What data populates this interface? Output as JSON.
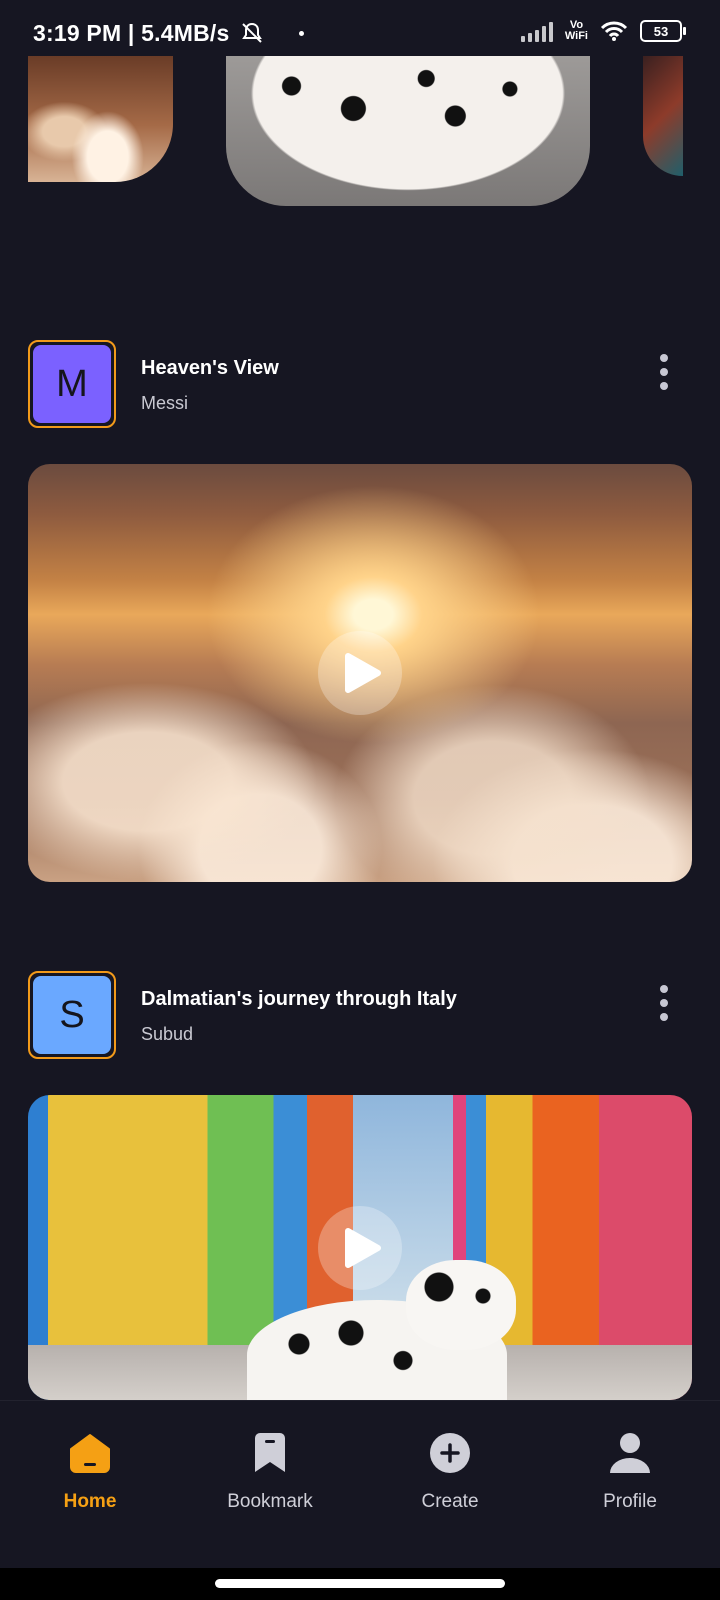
{
  "status_bar": {
    "left_text": "3:19 PM | 5.4MB/s",
    "vowifi_top": "Vo",
    "vowifi_bottom": "WiFi",
    "battery": "53"
  },
  "posts": [
    {
      "avatar_letter": "M",
      "avatar_color": "#7b61ff",
      "title": "Heaven's View",
      "author": "Messi"
    },
    {
      "avatar_letter": "S",
      "avatar_color": "#6aa8ff",
      "title": "Dalmatian's journey through Italy",
      "author": "Subud"
    }
  ],
  "nav": {
    "items": [
      {
        "label": "Home",
        "icon": "home-icon",
        "active": true
      },
      {
        "label": "Bookmark",
        "icon": "bookmark-icon",
        "active": false
      },
      {
        "label": "Create",
        "icon": "create-icon",
        "active": false
      },
      {
        "label": "Profile",
        "icon": "profile-icon",
        "active": false
      }
    ],
    "active_color": "#f5a014",
    "inactive_color": "#cfcfd8"
  }
}
